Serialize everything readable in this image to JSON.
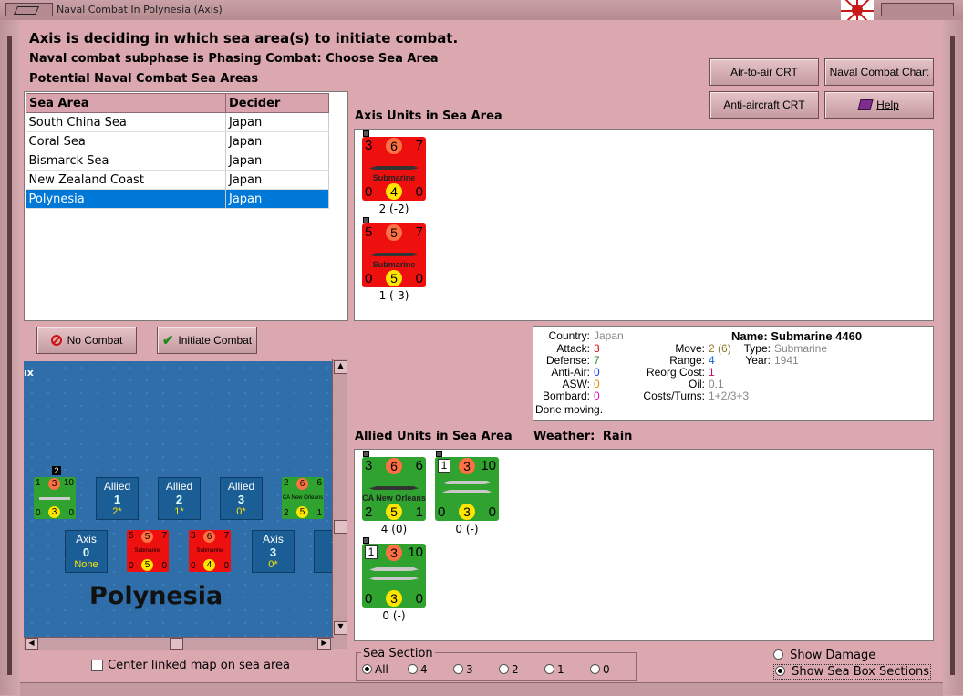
{
  "window": {
    "title": "Naval Combat In Polynesia (Axis)"
  },
  "header": {
    "line1": "Axis is deciding in which sea area(s) to initiate combat.",
    "line2": "Naval combat subphase is Phasing Combat: Choose Sea Area",
    "line3": "Potential Naval Combat Sea Areas"
  },
  "buttons": {
    "air_to_air": "Air-to-air CRT",
    "naval_chart": "Naval Combat Chart",
    "anti_aircraft": "Anti-aircraft CRT",
    "help": "Help",
    "no_combat": "No Combat",
    "initiate_combat": "Initiate Combat"
  },
  "sea_table": {
    "col1": "Sea Area",
    "col2": "Decider",
    "rows": [
      {
        "area": "South China Sea",
        "decider": "Japan"
      },
      {
        "area": "Coral Sea",
        "decider": "Japan"
      },
      {
        "area": "Bismarck Sea",
        "decider": "Japan"
      },
      {
        "area": "New Zealand Coast",
        "decider": "Japan"
      },
      {
        "area": "Polynesia",
        "decider": "Japan"
      }
    ],
    "selected_index": 4
  },
  "axis_units": {
    "heading": "Axis Units in Sea Area",
    "units": [
      {
        "tl": "3",
        "tc": "6",
        "tr": "7",
        "name": "Submarine",
        "bl": "0",
        "bc": "4",
        "br": "0",
        "caption": "2 (-2)"
      },
      {
        "tl": "5",
        "tc": "5",
        "tr": "7",
        "name": "Submarine",
        "bl": "0",
        "bc": "5",
        "br": "0",
        "caption": "1 (-3)"
      }
    ]
  },
  "unit_info": {
    "country_label": "Country:",
    "country": "Japan",
    "attack_label": "Attack:",
    "attack": "3",
    "defense_label": "Defense:",
    "defense": "7",
    "antiair_label": "Anti-Air:",
    "antiair": "0",
    "asw_label": "ASW:",
    "asw": "0",
    "bombard_label": "Bombard:",
    "bombard": "0",
    "move_label": "Move:",
    "move": "2",
    "move_extra": "(6)",
    "range_label": "Range:",
    "range": "4",
    "reorg_label": "Reorg Cost:",
    "reorg": "1",
    "oil_label": "Oil:",
    "oil": "0.1",
    "costs_label": "Costs/Turns:",
    "costs": "1+2/3+3",
    "name_label": "Name:",
    "name": "Submarine 4460",
    "type_label": "Type:",
    "type": "Submarine",
    "year_label": "Year:",
    "year": "1941",
    "status": "Done moving.",
    "colors": {
      "attack": "#e01010",
      "defense": "#2e8b2e",
      "antiair": "#1040e0",
      "asw": "#e08a00",
      "bombard": "#e010c0",
      "range": "#1060e0",
      "reorg": "#c01060",
      "move": "#8a7a2e",
      "grey": "#888888"
    }
  },
  "allied_units": {
    "heading": "Allied Units in Sea Area",
    "weather_label": "Weather:",
    "weather": "Rain",
    "units": [
      {
        "tl": "3",
        "tc": "6",
        "tr": "6",
        "name": "CA New Orleans",
        "bl": "2",
        "bc": "5",
        "br": "1",
        "caption": "4 (0)"
      },
      {
        "box": "1",
        "tc": "3",
        "tr": "10",
        "bl": "0",
        "bc": "3",
        "br": "0",
        "caption": "0 (-)"
      },
      {
        "box": "1",
        "tc": "3",
        "tr": "10",
        "bl": "0",
        "bc": "3",
        "br": "0",
        "caption": "0 (-)"
      }
    ]
  },
  "map": {
    "title": "Polynesia",
    "edge_label": "ıx",
    "boxes": [
      {
        "a": "Allied",
        "b": "1",
        "c": "2*"
      },
      {
        "a": "Allied",
        "b": "2",
        "c": "1*"
      },
      {
        "a": "Allied",
        "b": "3",
        "c": "0*"
      },
      {
        "a": "Axis",
        "b": "0",
        "c": "None"
      },
      {
        "a": "Axis",
        "b": "3",
        "c": "0*"
      },
      {
        "a": "A"
      }
    ],
    "minis": [
      {
        "tl": "1",
        "tc": "3",
        "tr": "10",
        "bl": "0",
        "bc": "3",
        "br": "0",
        "name": "",
        "flag": "2"
      },
      {
        "tl": "2",
        "tc": "6",
        "tr": "6",
        "bl": "2",
        "bc": "5",
        "br": "1",
        "name": "CA New Orleans"
      },
      {
        "tl": "5",
        "tc": "5",
        "tr": "7",
        "bl": "0",
        "bc": "5",
        "br": "0",
        "name": "Submarine"
      },
      {
        "tl": "3",
        "tc": "6",
        "tr": "7",
        "bl": "0",
        "bc": "4",
        "br": "0",
        "name": "Submarine"
      }
    ]
  },
  "center_map": {
    "label": "Center linked map on sea area",
    "checked": false
  },
  "sea_section": {
    "label": "Sea Section",
    "options": [
      "All",
      "4",
      "3",
      "2",
      "1",
      "0"
    ],
    "selected": "All"
  },
  "display_opts": {
    "show_damage": "Show Damage",
    "show_sections": "Show Sea Box Sections",
    "selected": "show_sections"
  }
}
